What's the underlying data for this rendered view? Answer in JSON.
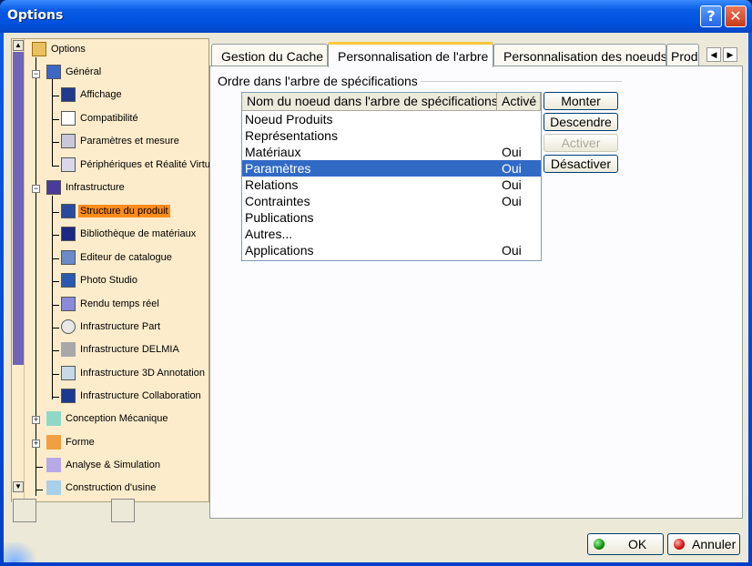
{
  "window": {
    "title": "Options"
  },
  "titlebar": {
    "help": "?",
    "close": "✕"
  },
  "tree": {
    "items": [
      {
        "label": "Options"
      },
      {
        "label": "Général"
      },
      {
        "label": "Affichage"
      },
      {
        "label": "Compatibilité"
      },
      {
        "label": "Paramètres et mesure"
      },
      {
        "label": "Périphériques et Réalité Virtue"
      },
      {
        "label": "Infrastructure"
      },
      {
        "label": "Structure du produit"
      },
      {
        "label": "Bibliothèque de matériaux"
      },
      {
        "label": "Editeur de catalogue"
      },
      {
        "label": "Photo Studio"
      },
      {
        "label": "Rendu temps réel"
      },
      {
        "label": "Infrastructure Part"
      },
      {
        "label": "Infrastructure DELMIA"
      },
      {
        "label": "Infrastructure 3D Annotation"
      },
      {
        "label": "Infrastructure Collaboration"
      },
      {
        "label": "Conception Mécanique"
      },
      {
        "label": "Forme"
      },
      {
        "label": "Analyse & Simulation"
      },
      {
        "label": "Construction d'usine"
      }
    ]
  },
  "tabs": [
    {
      "label": "Gestion du Cache"
    },
    {
      "label": "Personnalisation de l'arbre"
    },
    {
      "label": "Personnalisation des noeuds"
    },
    {
      "label": "Prod"
    }
  ],
  "group": {
    "title": "Ordre dans l'arbre de spécifications"
  },
  "list": {
    "columns": [
      "Nom du noeud dans l'arbre de spécifications",
      "Activé"
    ],
    "rows": [
      {
        "name": "Noeud Produits",
        "active": ""
      },
      {
        "name": "Représentations",
        "active": ""
      },
      {
        "name": "Matériaux",
        "active": "Oui"
      },
      {
        "name": "Paramètres",
        "active": "Oui"
      },
      {
        "name": "Relations",
        "active": "Oui"
      },
      {
        "name": "Contraintes",
        "active": "Oui"
      },
      {
        "name": "Publications",
        "active": ""
      },
      {
        "name": "Autres...",
        "active": ""
      },
      {
        "name": "Applications",
        "active": "Oui"
      }
    ]
  },
  "buttons": {
    "up": "Monter",
    "down": "Descendre",
    "activate": "Activer",
    "deactivate": "Désactiver"
  },
  "footer": {
    "ok": "OK",
    "cancel": "Annuler"
  },
  "colors": {
    "selection": "#316ac5",
    "tree_selection": "#ff8c1a",
    "tree_bg": "#fdeccb"
  }
}
